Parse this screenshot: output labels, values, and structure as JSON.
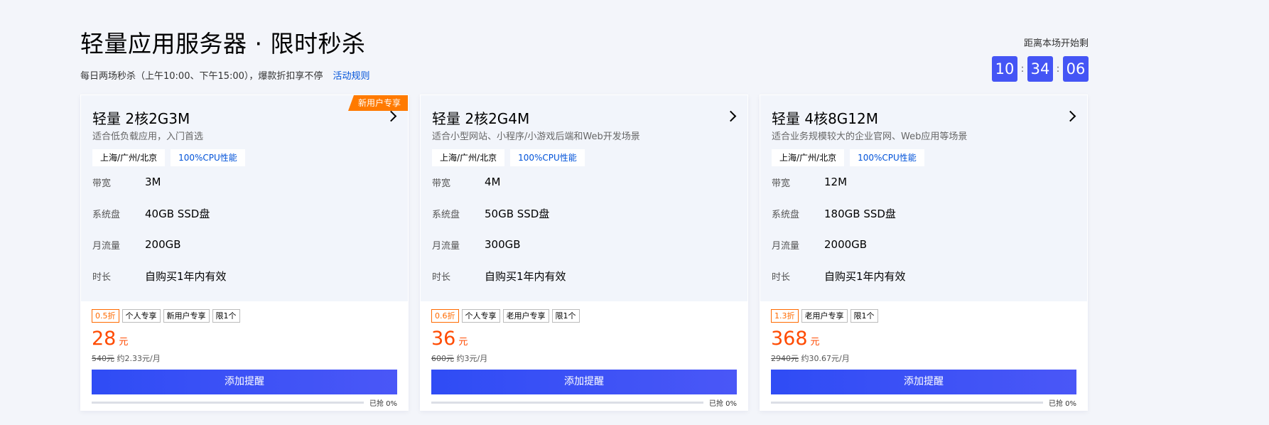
{
  "header": {
    "title": "轻量应用服务器 · 限时秒杀",
    "subtitle": "每日两场秒杀（上午10:00、下午15:00），爆款折扣享不停",
    "rules_link": "活动规则"
  },
  "countdown": {
    "label": "距离本场开始剩",
    "hours": "10",
    "minutes": "34",
    "seconds": "06",
    "separator": ":"
  },
  "cards": [
    {
      "title": "轻量 2核2G3M",
      "badge": "新用户专享",
      "desc": "适合低负载应用，入门首选",
      "region_tag": "上海/广州/北京",
      "cpu_tag": "100%CPU性能",
      "specs": [
        {
          "label": "带宽",
          "value": "3M"
        },
        {
          "label": "系统盘",
          "value": "40GB SSD盘"
        },
        {
          "label": "月流量",
          "value": "200GB"
        },
        {
          "label": "时长",
          "value": "自购买1年内有效"
        }
      ],
      "promo_tags": [
        "0.5折",
        "个人专享",
        "新用户专享",
        "限1个"
      ],
      "price": "28",
      "price_unit": "元",
      "original_price": "540元",
      "monthly": "约2.33元/月",
      "button": "添加提醒",
      "progress_text": "已抢 0%",
      "progress": 0
    },
    {
      "title": "轻量 2核2G4M",
      "badge": "",
      "desc": "适合小型网站、小程序/小游戏后端和Web开发场景",
      "region_tag": "上海/广州/北京",
      "cpu_tag": "100%CPU性能",
      "specs": [
        {
          "label": "带宽",
          "value": "4M"
        },
        {
          "label": "系统盘",
          "value": "50GB SSD盘"
        },
        {
          "label": "月流量",
          "value": "300GB"
        },
        {
          "label": "时长",
          "value": "自购买1年内有效"
        }
      ],
      "promo_tags": [
        "0.6折",
        "个人专享",
        "老用户专享",
        "限1个"
      ],
      "price": "36",
      "price_unit": "元",
      "original_price": "600元",
      "monthly": "约3元/月",
      "button": "添加提醒",
      "progress_text": "已抢 0%",
      "progress": 0
    },
    {
      "title": "轻量 4核8G12M",
      "badge": "",
      "desc": "适合业务规模较大的企业官网、Web应用等场景",
      "region_tag": "上海/广州/北京",
      "cpu_tag": "100%CPU性能",
      "specs": [
        {
          "label": "带宽",
          "value": "12M"
        },
        {
          "label": "系统盘",
          "value": "180GB SSD盘"
        },
        {
          "label": "月流量",
          "value": "2000GB"
        },
        {
          "label": "时长",
          "value": "自购买1年内有效"
        }
      ],
      "promo_tags": [
        "1.3折",
        "老用户专享",
        "限1个"
      ],
      "price": "368",
      "price_unit": "元",
      "original_price": "2940元",
      "monthly": "约30.67元/月",
      "button": "添加提醒",
      "progress_text": "已抢 0%",
      "progress": 0
    }
  ]
}
